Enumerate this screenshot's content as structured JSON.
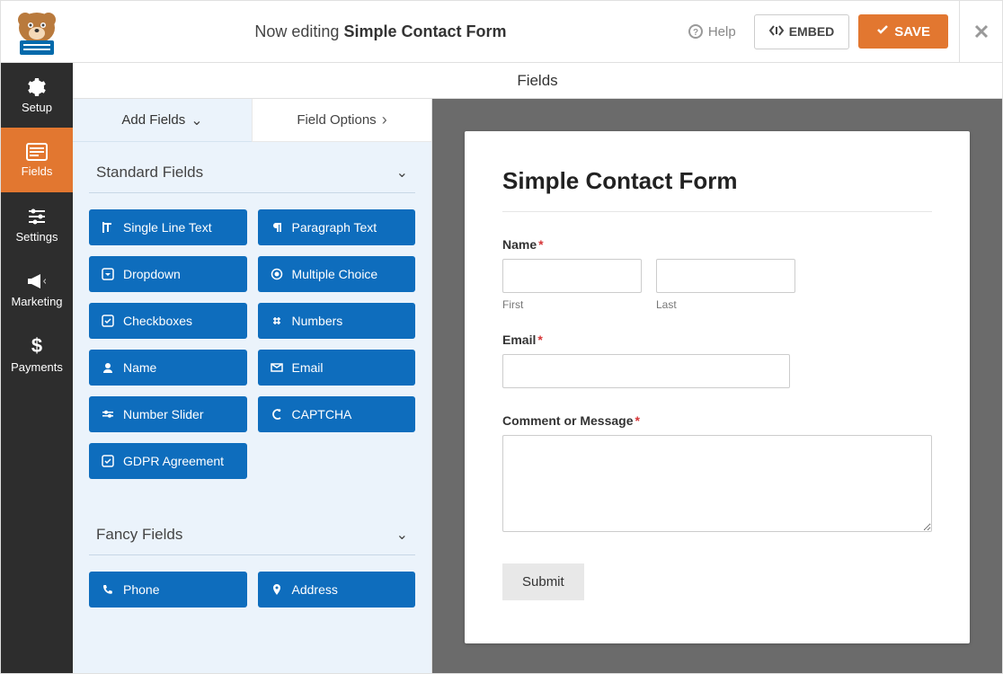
{
  "header": {
    "prefix": "Now editing",
    "formname": "Simple Contact Form",
    "help": "Help",
    "embed": "EMBED",
    "save": "SAVE"
  },
  "sidenav": {
    "setup": "Setup",
    "fields": "Fields",
    "settings": "Settings",
    "marketing": "Marketing",
    "payments": "Payments"
  },
  "subheader": "Fields",
  "tabs": {
    "add": "Add Fields",
    "options": "Field Options"
  },
  "groups": {
    "standard": "Standard Fields",
    "fancy": "Fancy Fields"
  },
  "fields": {
    "single_line": "Single Line Text",
    "paragraph": "Paragraph Text",
    "dropdown": "Dropdown",
    "multiple": "Multiple Choice",
    "checkboxes": "Checkboxes",
    "numbers": "Numbers",
    "name": "Name",
    "email": "Email",
    "slider": "Number Slider",
    "captcha": "CAPTCHA",
    "gdpr": "GDPR Agreement",
    "phone": "Phone",
    "address": "Address"
  },
  "preview": {
    "title": "Simple Contact Form",
    "name_label": "Name",
    "first": "First",
    "last": "Last",
    "email_label": "Email",
    "message_label": "Comment or Message",
    "submit": "Submit"
  }
}
